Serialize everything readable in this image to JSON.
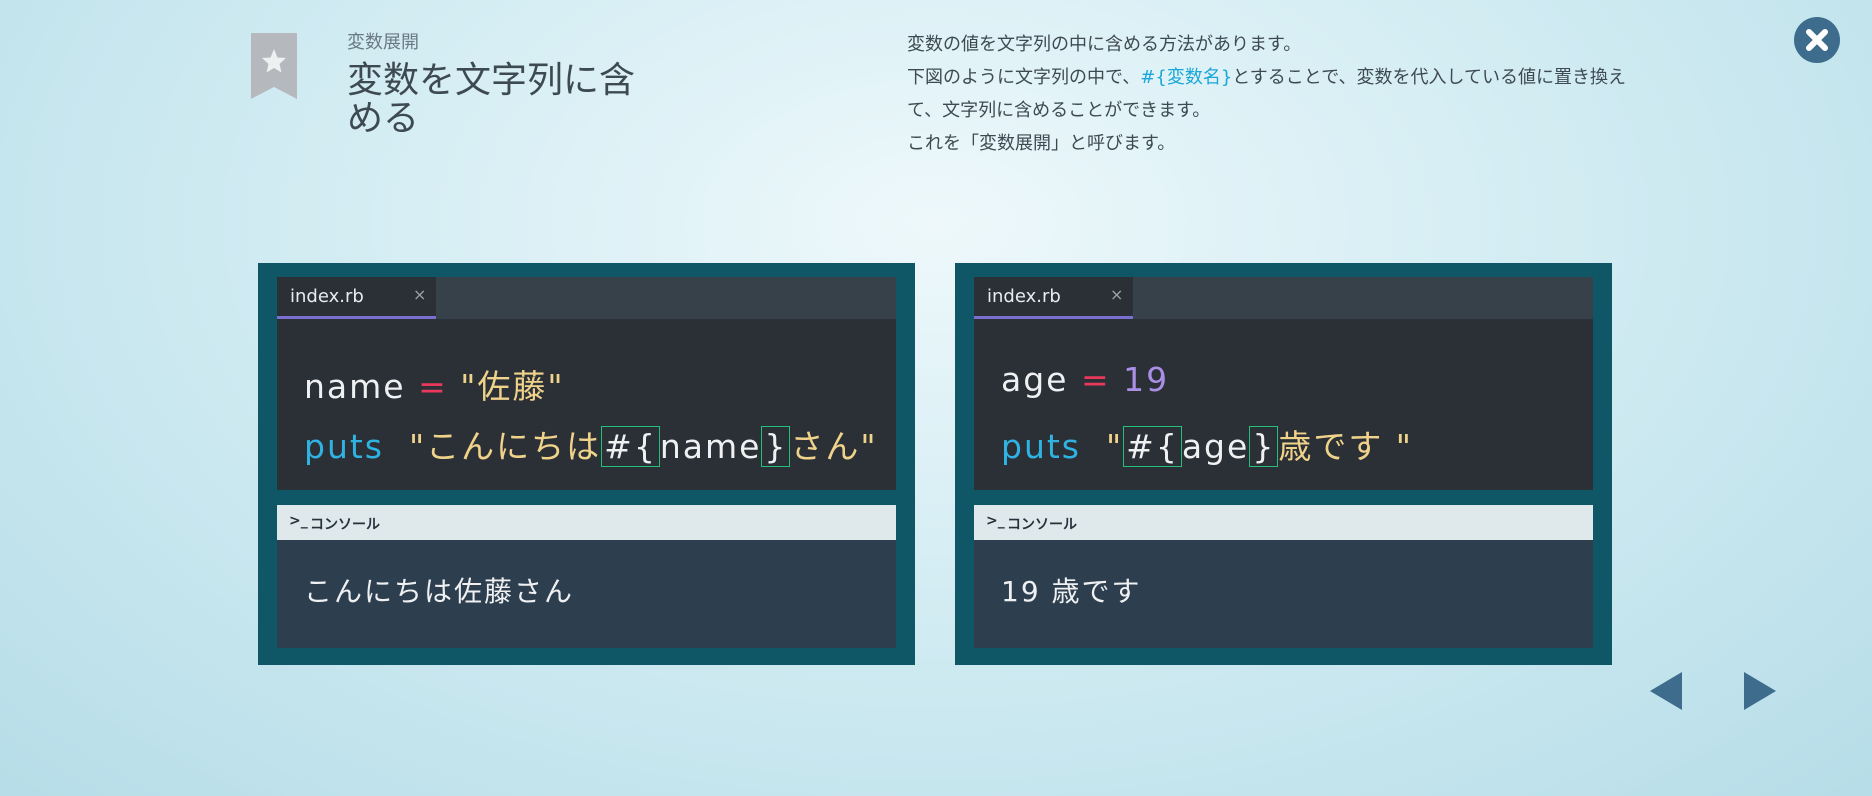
{
  "header": {
    "subtitle": "変数展開",
    "title": "変数を文字列に含める"
  },
  "description": {
    "line1": "変数の値を文字列の中に含める方法があります。",
    "line2_pre": "下図のように文字列の中で、",
    "line2_highlight": "#{変数名}",
    "line2_post": "とすることで、変数を代入している値に置き換えて、文字列に含めることができます。",
    "line3": "これを「変数展開」と呼びます。"
  },
  "examples": [
    {
      "tab": "index.rb",
      "tab_close": "×",
      "line1": {
        "var": "name",
        "op": "=",
        "str": "\"佐藤\""
      },
      "line2": {
        "kw": "puts",
        "str_start": "\"こんにちは",
        "open": "#{",
        "var": "name",
        "close": "}",
        "str_end": "さん\""
      },
      "console_label": "コンソール",
      "console_prompt": ">_",
      "output": "こんにちは佐藤さん"
    },
    {
      "tab": "index.rb",
      "tab_close": "×",
      "line1": {
        "var": "age",
        "op": "=",
        "num": "19"
      },
      "line2": {
        "kw": "puts",
        "str_start": "\"",
        "open": "#{",
        "var": "age",
        "close": "}",
        "str_end": "歳です \""
      },
      "console_label": "コンソール",
      "console_prompt": ">_",
      "output": "19 歳です"
    }
  ],
  "icons": {
    "bookmark": "star-bookmark-icon",
    "close": "close-icon",
    "prev": "prev-arrow-icon",
    "next": "next-arrow-icon"
  },
  "colors": {
    "accent": "#1aa7d8",
    "panel": "#0f5766",
    "keyword": "#2fb3e3",
    "string": "#f0d38a",
    "operator": "#e8385c",
    "number": "#a98fe6",
    "highlight_box": "#22c07a"
  }
}
